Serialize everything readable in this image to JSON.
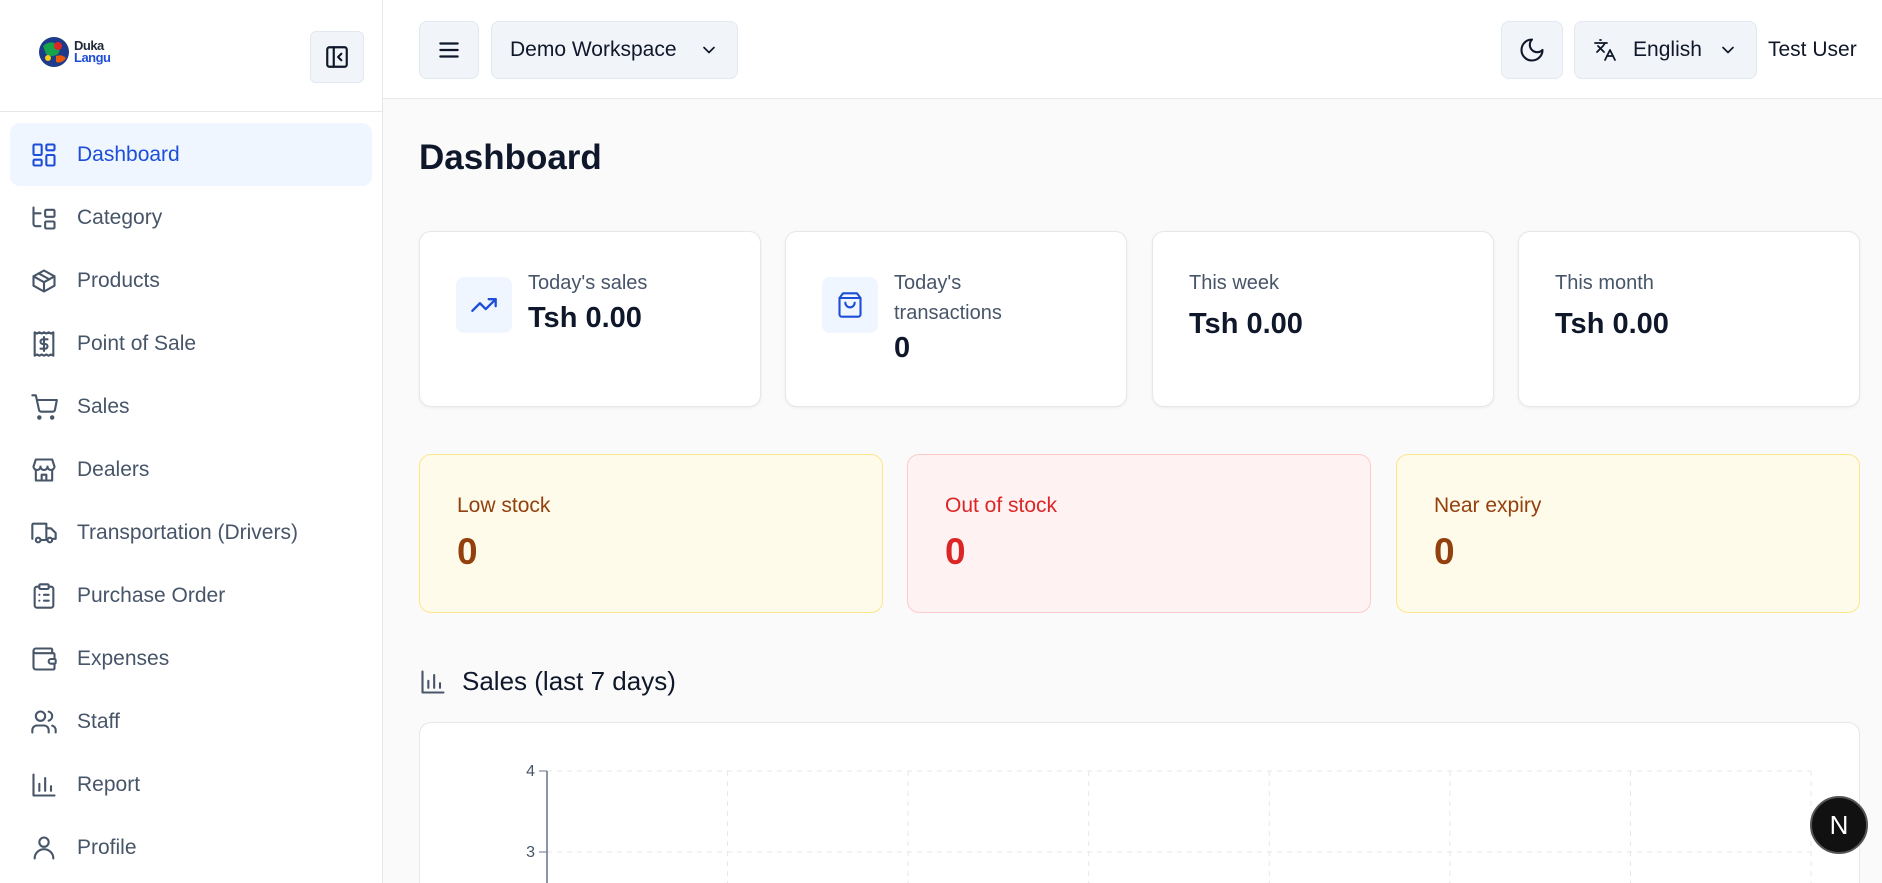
{
  "brand": {
    "logo_line1": "Duka",
    "logo_line2": "Langu"
  },
  "sidebar": {
    "items": [
      {
        "label": "Dashboard",
        "icon": "dashboard-icon",
        "active": true
      },
      {
        "label": "Category",
        "icon": "category-tree-icon"
      },
      {
        "label": "Products",
        "icon": "package-icon"
      },
      {
        "label": "Point of Sale",
        "icon": "receipt-dollar-icon"
      },
      {
        "label": "Sales",
        "icon": "cart-icon"
      },
      {
        "label": "Dealers",
        "icon": "store-icon"
      },
      {
        "label": "Transportation (Drivers)",
        "icon": "truck-icon"
      },
      {
        "label": "Purchase Order",
        "icon": "clipboard-icon"
      },
      {
        "label": "Expenses",
        "icon": "wallet-icon"
      },
      {
        "label": "Staff",
        "icon": "users-icon"
      },
      {
        "label": "Report",
        "icon": "bar-chart-icon"
      },
      {
        "label": "Profile",
        "icon": "user-icon"
      }
    ]
  },
  "header": {
    "workspace": "Demo Workspace",
    "language": "English",
    "user": "Test User"
  },
  "main": {
    "title": "Dashboard",
    "stats": [
      {
        "label": "Today's sales",
        "value": "Tsh 0.00"
      },
      {
        "label_line1": "Today's",
        "label_line2": "transactions",
        "value": "0"
      },
      {
        "label": "This week",
        "value": "Tsh 0.00"
      },
      {
        "label": "This month",
        "value": "Tsh 0.00"
      }
    ],
    "alerts": [
      {
        "label": "Low stock",
        "value": "0"
      },
      {
        "label": "Out of stock",
        "value": "0"
      },
      {
        "label": "Near expiry",
        "value": "0"
      }
    ],
    "sales_section_title": "Sales (last 7 days)"
  },
  "chart_data": {
    "type": "line",
    "categories": [],
    "series": [],
    "yticks": [
      "4",
      "3"
    ],
    "ylim": [
      0,
      4
    ],
    "grid": true
  },
  "fab": {
    "label": "N"
  },
  "colors": {
    "accent": "#1d4ed8",
    "active_bg": "#eff6ff",
    "warning": "#92400e",
    "danger": "#dc2626"
  }
}
